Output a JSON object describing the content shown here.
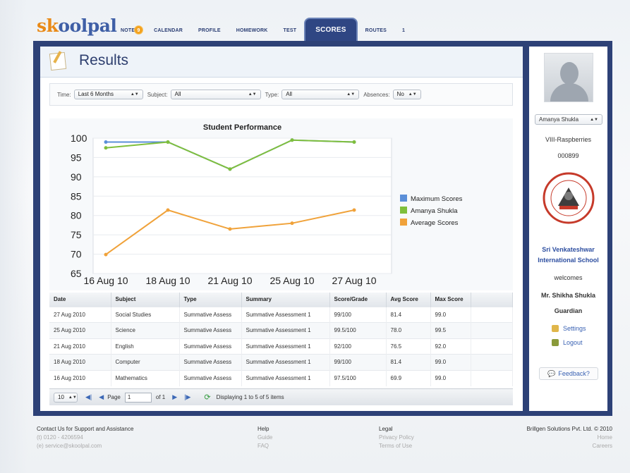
{
  "logo": {
    "text_s": "sk",
    "text_rest": "oolpal"
  },
  "nav": {
    "items": [
      {
        "label": "NOTES",
        "badge": "9"
      },
      {
        "label": "CALENDAR"
      },
      {
        "label": "PROFILE"
      },
      {
        "label": "HOMEWORK"
      },
      {
        "label": "TEST"
      },
      {
        "label": "SCORES",
        "active": true
      },
      {
        "label": "ROUTES"
      },
      {
        "label": "1"
      }
    ]
  },
  "results": {
    "title": "Results",
    "filters": {
      "time_label": "Time:",
      "time_value": "Last 6 Months",
      "subject_label": "Subject:",
      "subject_value": "All",
      "type_label": "Type:",
      "type_value": "All",
      "absences_label": "Absences:",
      "absences_value": "No"
    }
  },
  "chart_data": {
    "type": "line",
    "title": "Student Performance",
    "categories": [
      "16 Aug 10",
      "18 Aug 10",
      "21 Aug 10",
      "25 Aug 10",
      "27 Aug 10"
    ],
    "ylim": [
      65,
      100
    ],
    "yticks": [
      100,
      95,
      90,
      85,
      80,
      75,
      70,
      65
    ],
    "series": [
      {
        "name": "Maximum Scores",
        "color": "#5b8fd8",
        "values": [
          99.0,
          99.0,
          92.0,
          99.5,
          99.0
        ]
      },
      {
        "name": "Amanya Shukla",
        "color": "#7fbf3c",
        "values": [
          97.5,
          99.0,
          92.0,
          99.5,
          99.0
        ]
      },
      {
        "name": "Average Scores",
        "color": "#f0a23a",
        "values": [
          69.9,
          81.4,
          76.5,
          78.0,
          81.4
        ]
      }
    ],
    "legend": "right",
    "grid": true
  },
  "table": {
    "headers": [
      "Date",
      "Subject",
      "Type",
      "Summary",
      "Score/Grade",
      "Avg Score",
      "Max Score"
    ],
    "rows": [
      [
        "27 Aug 2010",
        "Social Studies",
        "Summative Assess",
        "Summative Assessment 1",
        "99/100",
        "81.4",
        "99.0"
      ],
      [
        "25 Aug 2010",
        "Science",
        "Summative Assess",
        "Summative Assessment 1",
        "99.5/100",
        "78.0",
        "99.5"
      ],
      [
        "21 Aug 2010",
        "English",
        "Summative Assess",
        "Summative Assessment 1",
        "92/100",
        "76.5",
        "92.0"
      ],
      [
        "18 Aug 2010",
        "Computer",
        "Summative Assess",
        "Summative Assessment 1",
        "99/100",
        "81.4",
        "99.0"
      ],
      [
        "16 Aug 2010",
        "Mathematics",
        "Summative Assess",
        "Summative Assessment 1",
        "97.5/100",
        "69.9",
        "99.0"
      ]
    ]
  },
  "pager": {
    "page_size": "10",
    "page_label": "Page",
    "page_value": "1",
    "of_label": "of 1",
    "displaying": "Displaying 1 to 5 of 5 items"
  },
  "sidebar": {
    "student_select": "Amanya Shukla",
    "class": "VIII-Raspberries",
    "id": "000899",
    "school_line1": "Sri Venkateshwar",
    "school_line2": "International School",
    "welcomes": "welcomes",
    "guardian_name": "Mr. Shikha Shukla",
    "guardian_role": "Guardian",
    "settings": "Settings",
    "logout": "Logout",
    "feedback": "Feedback?"
  },
  "footer": {
    "contact_title": "Contact Us for Support and Assistance",
    "contact_phone": "(t) 0120 - 4206594",
    "contact_email": "(e) service@skoolpal.com",
    "help": "Help",
    "guide": "Guide",
    "faq": "FAQ",
    "legal": "Legal",
    "privacy": "Privacy Policy",
    "terms": "Terms of Use",
    "company": "Brillgen Solutions Pvt. Ltd. © 2010",
    "home": "Home",
    "careers": "Careers"
  },
  "colors": {
    "navy": "#2d4177",
    "accent": "#3a62b3",
    "orange": "#e98a17"
  }
}
